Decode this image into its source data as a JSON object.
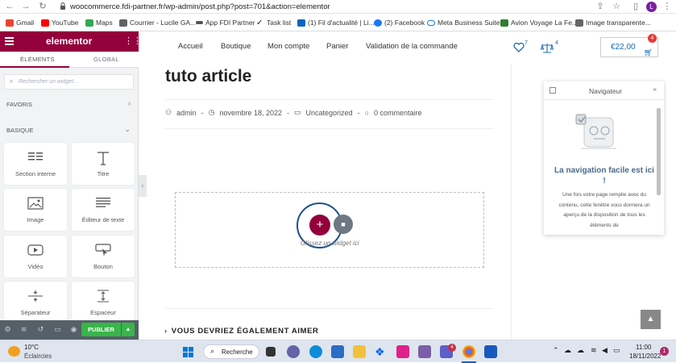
{
  "browser": {
    "url": "woocommerce.fdi-partner.fr/wp-admin/post.php?post=701&action=elementor",
    "profile_initial": "L",
    "bookmarks": [
      {
        "label": "Gmail",
        "color": "#ea4335"
      },
      {
        "label": "YouTube",
        "color": "#ff0000"
      },
      {
        "label": "Maps",
        "color": "#34a853"
      },
      {
        "label": "Courrier - Lucile GA...",
        "color": "#5f6368"
      },
      {
        "label": "App FDI Partner",
        "color": "#555555"
      },
      {
        "label": "Task list",
        "color": "#222222"
      },
      {
        "label": "(1) Fil d'actualité | Li...",
        "color": "#0a66c2"
      },
      {
        "label": "(2) Facebook",
        "color": "#1877f2"
      },
      {
        "label": "Meta Business Suite",
        "color": "#1877f2"
      },
      {
        "label": "Avion Voyage La Fe...",
        "color": "#2e7d32"
      },
      {
        "label": "Image transparente...",
        "color": "#666666"
      }
    ]
  },
  "panel": {
    "brand": "elementor",
    "tabs": [
      "ÉLÉMENTS",
      "GLOBAL"
    ],
    "search_placeholder": "Rechercher un widget...",
    "sections": {
      "favoris": "FAVORIS",
      "basique": "BASIQUE"
    },
    "widgets": [
      "Section interne",
      "Titre",
      "Image",
      "Éditeur de texte",
      "Vidéo",
      "Bouton",
      "Séparateur",
      "Espaceur"
    ],
    "publish_label": "PUBLIER"
  },
  "site": {
    "menu": [
      "Accueil",
      "Boutique",
      "Mon compte",
      "Panier",
      "Validation de la commande"
    ],
    "wishlist_count": "7",
    "compare_count": "4",
    "cart_total": "€22,00",
    "cart_count": "4",
    "post_title": "tuto article",
    "meta": {
      "author": "admin",
      "date": "novembre 18, 2022",
      "category": "Uncategorized",
      "comments": "0 commentaire"
    },
    "dropzone_text": "Glissez un widget ici",
    "related_heading": "VOUS DEVRIEZ ÉGALEMENT AIMER"
  },
  "navigator": {
    "title": "Navigateur",
    "empty_title": "La navigation facile est ici !",
    "empty_text": "Une fois votre page remplie avec du contenu, cette fenêtre vous donnera un aperçu de la disposition de tous les éléments de"
  },
  "taskbar": {
    "weather_temp": "10°C",
    "weather_desc": "Éclaircies",
    "search_label": "Recherche",
    "time": "11:00",
    "date": "18/11/2022",
    "teams_badge": "4",
    "notif_count": "1"
  },
  "colors": {
    "elementor": "#93003c",
    "publish": "#39b54a",
    "link": "#1e6ab4"
  }
}
